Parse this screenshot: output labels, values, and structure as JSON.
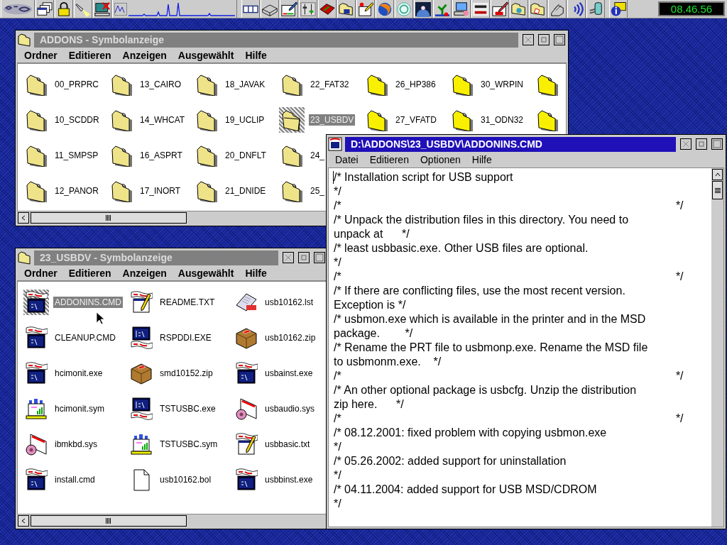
{
  "taskbar": {
    "clock": "08.46.56"
  },
  "addons_window": {
    "title": "ADDONS - Symbolanzeige",
    "active": false,
    "menu": [
      "Ordner",
      "Editieren",
      "Anzeigen",
      "Ausgewählt",
      "Hilfe"
    ],
    "columns": [
      [
        {
          "label": "00_PRPRC",
          "kind": "folder",
          "selected": false
        },
        {
          "label": "10_SCDDR",
          "kind": "folder",
          "selected": false
        },
        {
          "label": "11_SMPSP",
          "kind": "folder",
          "selected": false
        },
        {
          "label": "12_PANOR",
          "kind": "folder",
          "selected": false
        }
      ],
      [
        {
          "label": "13_CAIRO",
          "kind": "folder",
          "selected": false
        },
        {
          "label": "14_WHCAT",
          "kind": "folder",
          "selected": false
        },
        {
          "label": "16_ASPRT",
          "kind": "folder",
          "selected": false
        },
        {
          "label": "17_INORT",
          "kind": "folder",
          "selected": false
        }
      ],
      [
        {
          "label": "18_JAVAK",
          "kind": "folder",
          "selected": false
        },
        {
          "label": "19_UCLIP",
          "kind": "folder",
          "selected": false
        },
        {
          "label": "20_DNFLT",
          "kind": "folder",
          "selected": false
        },
        {
          "label": "21_DNIDE",
          "kind": "folder",
          "selected": false
        }
      ],
      [
        {
          "label": "22_FAT32",
          "kind": "folder",
          "selected": false
        },
        {
          "label": "23_USBDV",
          "kind": "folder",
          "selected": true
        },
        {
          "label": "24_",
          "kind": "folder",
          "selected": false
        },
        {
          "label": "25_",
          "kind": "folder",
          "selected": false
        }
      ],
      [
        {
          "label": "26_HP386",
          "kind": "bright-folder",
          "selected": false
        },
        {
          "label": "27_VFATD",
          "kind": "bright-folder",
          "selected": false
        }
      ],
      [
        {
          "label": "30_WRPIN",
          "kind": "bright-folder",
          "selected": false
        },
        {
          "label": "31_ODN32",
          "kind": "bright-folder",
          "selected": false
        }
      ],
      [
        {
          "kind": "bright-folder",
          "selected": false
        },
        {
          "kind": "bright-folder",
          "selected": false
        }
      ]
    ]
  },
  "usbdv_window": {
    "title": "23_USBDV - Symbolanzeige",
    "active": false,
    "menu": [
      "Ordner",
      "Editieren",
      "Anzeigen",
      "Ausgewählt",
      "Hilfe"
    ],
    "columns": [
      [
        {
          "label": "ADDONINS.CMD",
          "kind": "command",
          "selected": true
        },
        {
          "label": "CLEANUP.CMD",
          "kind": "command",
          "selected": false
        },
        {
          "label": "hcimonit.exe",
          "kind": "command",
          "selected": false
        },
        {
          "label": "hcimonit.sym",
          "kind": "chart",
          "selected": false
        },
        {
          "label": "ibmkbd.sys",
          "kind": "driver",
          "selected": false
        },
        {
          "label": "install.cmd",
          "kind": "command",
          "selected": false
        }
      ],
      [
        {
          "label": "README.TXT",
          "kind": "text",
          "selected": false
        },
        {
          "label": "RSPDDI.EXE",
          "kind": "program",
          "selected": false
        },
        {
          "label": "smd10152.zip",
          "kind": "package",
          "selected": false
        },
        {
          "label": "TSTUSBC.exe",
          "kind": "program",
          "selected": false
        },
        {
          "label": "TSTUSBC.sym",
          "kind": "chart",
          "selected": false
        },
        {
          "label": "usb10162.bol",
          "kind": "blank",
          "selected": false
        }
      ],
      [
        {
          "label": "usb10162.lst",
          "kind": "list",
          "selected": false
        },
        {
          "label": "usb10162.zip",
          "kind": "package",
          "selected": false
        },
        {
          "label": "usbainst.exe",
          "kind": "command",
          "selected": false
        },
        {
          "label": "usbaudio.sys",
          "kind": "driver",
          "selected": false
        },
        {
          "label": "usbbasic.txt",
          "kind": "text",
          "selected": false
        },
        {
          "label": "usbbinst.exe",
          "kind": "command",
          "selected": false
        }
      ]
    ]
  },
  "editor_window": {
    "title": "D:\\ADDONS\\23_USBDV\\ADDONINS.CMD",
    "active": true,
    "menu": [
      "Datei",
      "Editieren",
      "Optionen",
      "Hilfe"
    ],
    "lines": [
      "/* Installation script for USB support",
      "*/",
      "/*                                                                                                          */",
      "/* Unpack the distribution files in this directory. You need to",
      "unpack at      */",
      "/* least usbbasic.exe. Other USB files are optional.",
      "*/",
      "/*                                                                                                          */",
      "/* If there are conflicting files, use the most recent version.",
      "Exception is */",
      "/* usbmon.exe which is available in the printer and in the MSD",
      "package.        */",
      "/* Rename the PRT file to usbmonp.exe. Rename the MSD file",
      "to usbmonm.exe.    */",
      "/*                                                                                                          */",
      "/* An other optional package is usbcfg. Unzip the distribution",
      "zip here.      */",
      "/*                                                                                                          */",
      "/* 08.12.2001: fixed problem with copying usbmon.exe",
      "*/",
      "/* 05.26.2002: added support for uninstallation",
      "*/",
      "/* 04.11.2004: added support for USB MSD/CDROM",
      "*/"
    ]
  }
}
